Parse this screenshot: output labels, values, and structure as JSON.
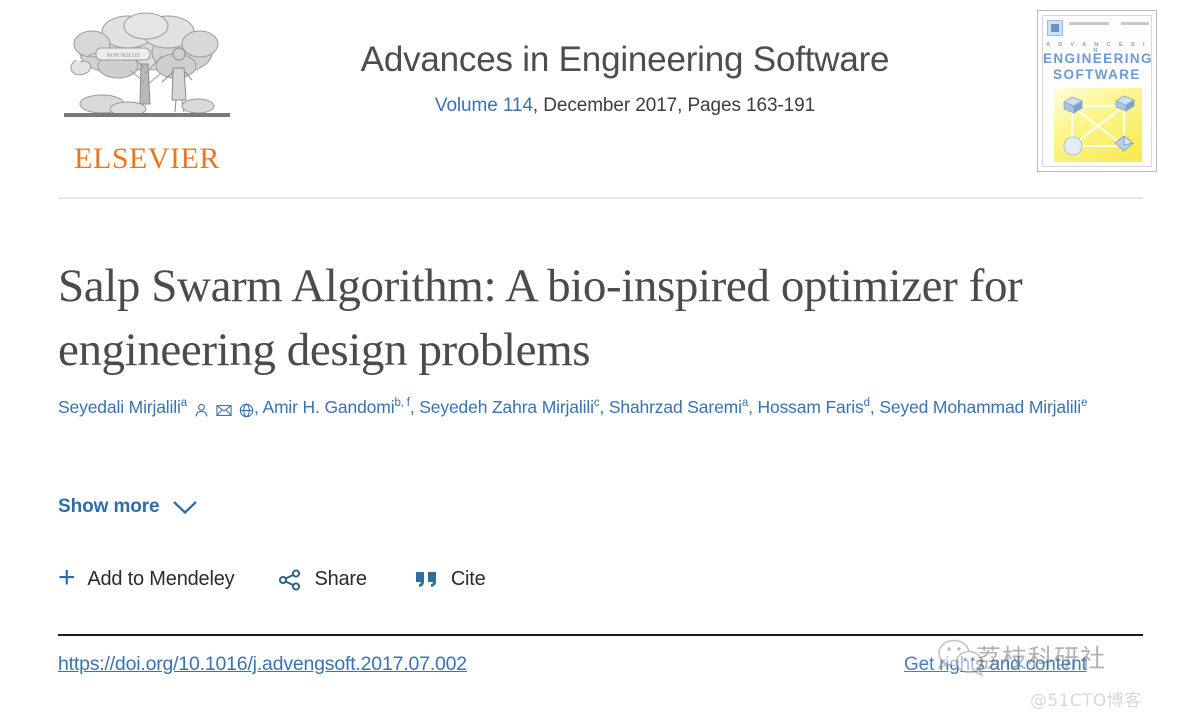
{
  "publisher": {
    "name": "ELSEVIER",
    "logo_icon": "elsevier-tree-logo",
    "motto": "NON SOLUS"
  },
  "journal": {
    "title": "Advances in Engineering Software",
    "volume_label": "Volume 114",
    "issue_info": ", December 2017, Pages 163-191",
    "cover": {
      "line_advances": "A D V A N C E S   I N",
      "line_engineering": "ENGINEERING",
      "line_software": "SOFTWARE"
    }
  },
  "article": {
    "title": "Salp Swarm Algorithm: A bio-inspired optimizer for engineering design problems",
    "authors": [
      {
        "name": "Seyedali Mirjalili",
        "affiliation": "a",
        "icons": [
          "person-icon",
          "envelope-icon",
          "globe-icon"
        ],
        "separator": ", "
      },
      {
        "name": "Amir H. Gandomi",
        "affiliation": "b, f",
        "icons": [],
        "separator": ", "
      },
      {
        "name": "Seyedeh Zahra Mirjalili",
        "affiliation": "c",
        "icons": [],
        "separator": ", "
      },
      {
        "name": "Shahrzad Saremi",
        "affiliation": "a",
        "icons": [],
        "separator": ", "
      },
      {
        "name": "Hossam Faris",
        "affiliation": "d",
        "icons": [],
        "separator": ", "
      },
      {
        "name": "Seyed Mohammad Mirjalili",
        "affiliation": "e",
        "icons": [],
        "separator": ""
      }
    ],
    "show_more_label": "Show more",
    "show_more_icon": "chevron-down-icon",
    "doi": "https://doi.org/10.1016/j.advengsoft.2017.07.002",
    "rights_label": "Get rights and content"
  },
  "actions": [
    {
      "label": "Add to Mendeley",
      "icon": "plus-icon"
    },
    {
      "label": "Share",
      "icon": "share-nodes-icon"
    },
    {
      "label": "Cite",
      "icon": "quote-icon"
    }
  ],
  "watermark": {
    "logo_icon": "wechat-icon",
    "chinese_text": "荔枝科研社",
    "credit": "@51CTO博客"
  },
  "colors": {
    "link_blue": "#3973b0",
    "accent_blue": "#2e6cab",
    "elsevier_orange": "#e87722",
    "title_gray": "#4b4b4b",
    "rule_light": "#e8e8e8",
    "rule_dark": "#1a1a1a"
  }
}
